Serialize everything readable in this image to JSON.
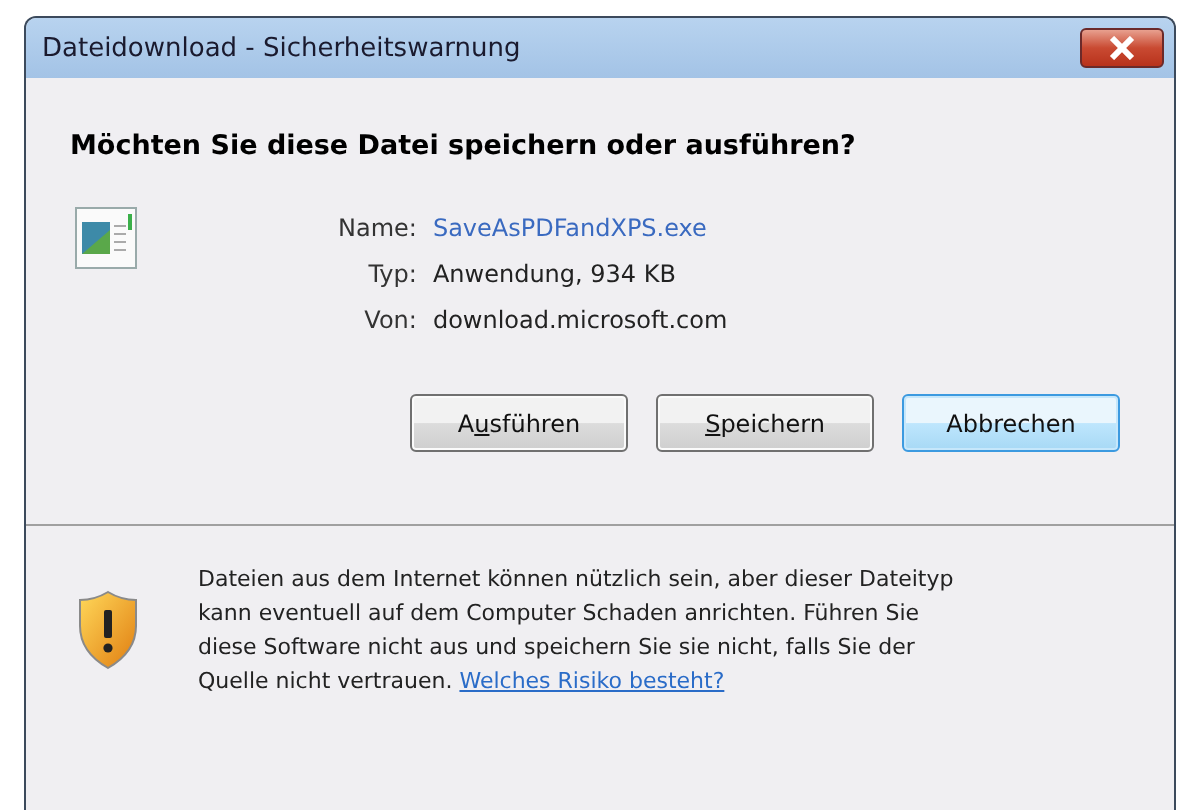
{
  "window": {
    "title": "Dateidownload - Sicherheitswarnung"
  },
  "question": "Möchten Sie diese Datei speichern oder ausführen?",
  "details": [
    {
      "label": "Name:",
      "value": "SaveAsPDFandXPS.exe",
      "kind": "link"
    },
    {
      "label": "Typ:",
      "value": "Anwendung, 934 KB",
      "kind": "text"
    },
    {
      "label": "Von:",
      "value": "download.microsoft.com",
      "kind": "text"
    }
  ],
  "buttons": [
    {
      "label_before": "A",
      "access_key": "u",
      "label_after": "sführen",
      "default": false
    },
    {
      "access_key": "S",
      "label_after": "peichern",
      "default": false
    },
    {
      "label_after": "Abbrechen",
      "default": true
    }
  ],
  "warning": {
    "text": "Dateien aus dem Internet können nützlich sein, aber dieser Dateityp kann eventuell auf dem Computer Schaden anrichten. Führen Sie diese Software nicht aus und speichern Sie sie nicht, falls Sie der Quelle nicht vertrauen.",
    "link": "Welches Risiko besteht?"
  }
}
